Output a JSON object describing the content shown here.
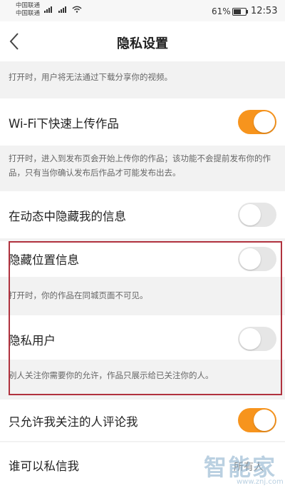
{
  "status_bar": {
    "carrier_1": "中国联通",
    "carrier_2": "中国联通",
    "battery_percent": "61%",
    "battery_level": 0.61,
    "time": "12:53"
  },
  "header": {
    "title": "隐私设置",
    "back_icon": "chevron-left-icon"
  },
  "settings": {
    "download_desc": "打开时，用户将无法通过下载分享你的视频。",
    "wifi_upload": {
      "label": "Wi-Fi下快速上传作品",
      "enabled": true,
      "desc": "打开时，进入到发布页会开始上传你的作品；该功能不会提前发布你的作品，只有当你确认发布后作品才可能发布出去。"
    },
    "hide_in_feed": {
      "label": "在动态中隐藏我的信息",
      "enabled": false
    },
    "hide_location": {
      "label": "隐藏位置信息",
      "enabled": false,
      "desc": "打开时，你的作品在同城页面不可见。"
    },
    "private_user": {
      "label": "隐私用户",
      "enabled": false,
      "desc": "别人关注你需要你的允许，作品只展示给已关注你的人。"
    },
    "comment_limit": {
      "label": "只允许我关注的人评论我",
      "enabled": true
    },
    "who_can_message": {
      "label": "谁可以私信我",
      "value": "所有人"
    }
  },
  "colors": {
    "accent": "#f7941d",
    "highlight_border": "#b0323e",
    "toggle_off": "#e6e6e6"
  },
  "watermark": {
    "text": "智能家",
    "url": "www.znj.com"
  }
}
